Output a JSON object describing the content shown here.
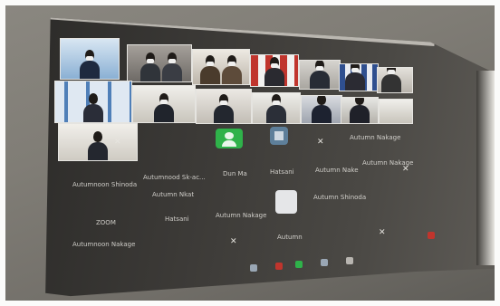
{
  "scene": {
    "subject": "projected-video-conference-gallery",
    "colors": {
      "screen": "#3a3835",
      "wall": "#7d7a73",
      "accent_green": "#2fb24a",
      "accent_red": "#c0352d"
    }
  },
  "conference": {
    "participant_labels": [
      "Autumnoon Shinoda",
      "Autumnood Sk-ac...",
      "Autumn Nkat",
      "Dun Ma",
      "Hatsani",
      "Autumn Nake",
      "ZOOM",
      "Hatsani",
      "Autumn Nakage",
      "Autumn Shinoda",
      "Autumn Nakage",
      "Autumn Nakage",
      "Autumnoon Nakage",
      "Autumn"
    ]
  }
}
